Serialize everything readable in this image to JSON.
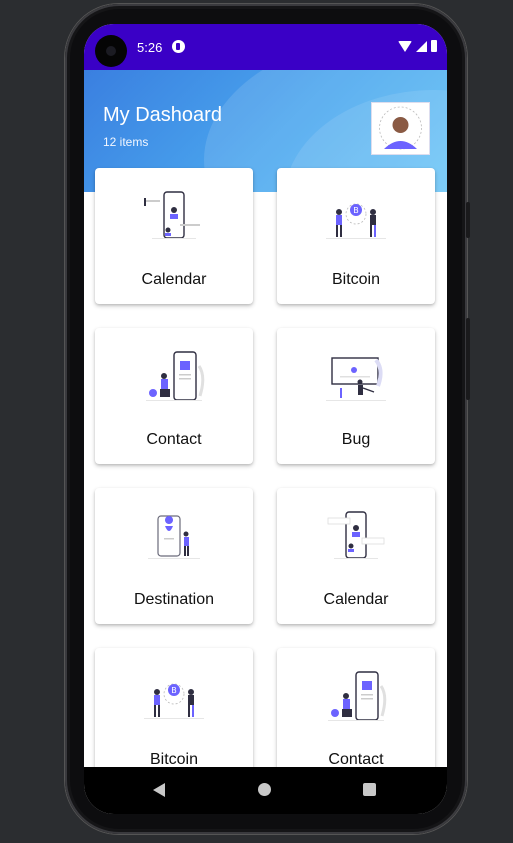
{
  "status_bar": {
    "time": "5:26"
  },
  "header": {
    "title": "My Dashoard",
    "subtitle": "12 items"
  },
  "colors": {
    "status_bar": "#3a00c6",
    "header_start": "#3a7fe0",
    "header_end": "#5cc0f6",
    "accent": "#6c63ff"
  },
  "cards": [
    {
      "label": "Calendar",
      "icon": "calendar-illustration"
    },
    {
      "label": "Bitcoin",
      "icon": "bitcoin-illustration"
    },
    {
      "label": "Contact",
      "icon": "contact-illustration"
    },
    {
      "label": "Bug",
      "icon": "bug-illustration"
    },
    {
      "label": "Destination",
      "icon": "destination-illustration"
    },
    {
      "label": "Calendar",
      "icon": "calendar-illustration"
    },
    {
      "label": "Bitcoin",
      "icon": "bitcoin-illustration"
    },
    {
      "label": "Contact",
      "icon": "contact-illustration"
    }
  ],
  "nav_bar": {
    "back": "back-icon",
    "home": "home-icon",
    "recents": "recents-icon"
  }
}
